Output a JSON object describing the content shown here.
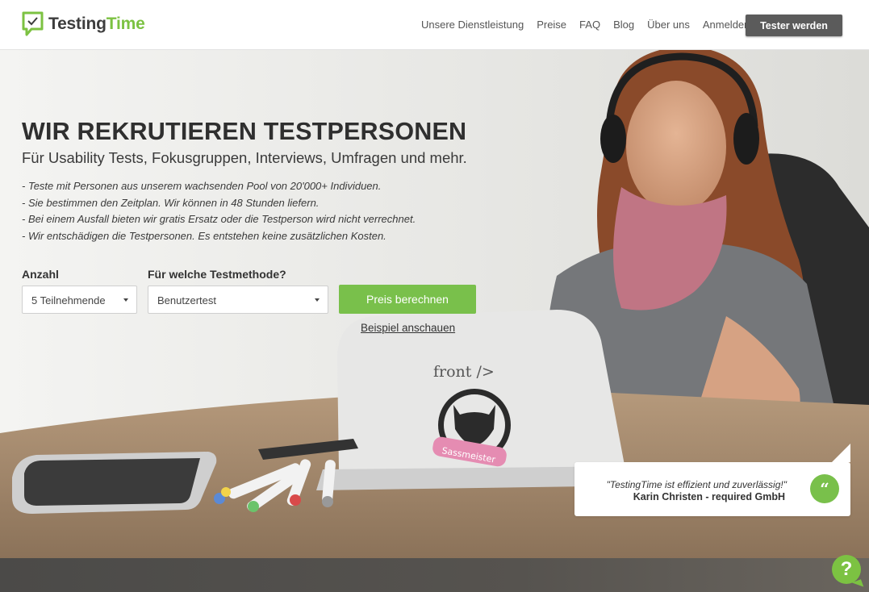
{
  "header": {
    "logo": {
      "part1": "Testing",
      "part2": "Time",
      "icon": "chat-check-icon"
    },
    "nav": [
      {
        "label": "Unsere Dienstleistung"
      },
      {
        "label": "Preise"
      },
      {
        "label": "FAQ"
      },
      {
        "label": "Blog"
      },
      {
        "label": "Über uns"
      },
      {
        "label": "Anmelden"
      }
    ],
    "cta_label": "Tester werden"
  },
  "hero": {
    "title": "WIR REKRUTIEREN TESTPERSONEN",
    "subtitle": "Für Usability Tests, Fokusgruppen, Interviews, Umfragen und mehr.",
    "bullets": [
      "- Teste mit Personen aus unserem wachsenden Pool von 20'000+ Individuen.",
      "- Sie bestimmen den Zeitplan. Wir können in 48 Stunden liefern.",
      "- Bei einem Ausfall bieten wir gratis Ersatz oder die Testperson wird nicht verrechnet.",
      "- Wir entschädigen die Testpersonen. Es entstehen keine zusätzlichen Kosten."
    ],
    "form": {
      "count_label": "Anzahl",
      "count_value": "5 Teilnehmende",
      "method_label": "Für welche Testmethode?",
      "method_value": "Benutzertest",
      "submit_label": "Preis berechnen",
      "example_link": "Beispiel anschauen"
    },
    "image_text": {
      "sticker": "front />",
      "sticker2": "Sassmeister"
    }
  },
  "testimonial": {
    "quote": "\"TestingTime ist effizient und zuverlässig!\"",
    "author": "Karin Christen - required GmbH",
    "badge": "“"
  },
  "help": {
    "label": "?",
    "icon": "help-chat-icon"
  },
  "colors": {
    "brand_green": "#79c04b",
    "dark_button": "#5b5b5b",
    "text": "#333333"
  }
}
